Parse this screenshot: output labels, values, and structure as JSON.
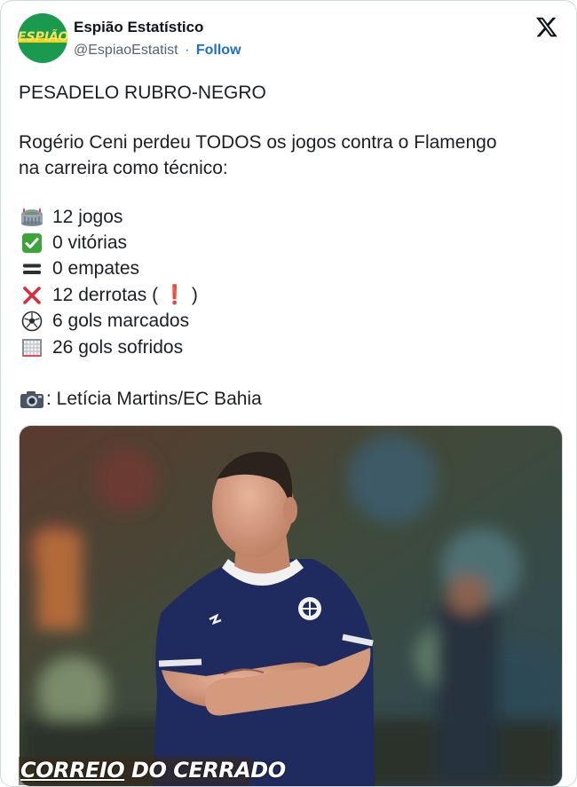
{
  "account": {
    "name": "Espião Estatístico",
    "handle": "@EspiaoEstatist",
    "separator": "·",
    "follow_label": "Follow",
    "avatar_text": "ESPIÃO"
  },
  "tweet": {
    "headline": "PESADELO RUBRO-NEGRO",
    "body_line1": "Rogério Ceni perdeu TODOS os jogos contra o Flamengo",
    "body_line2": "na carreira como técnico:",
    "stats": [
      {
        "icon": "stadium-icon",
        "text": "12 jogos"
      },
      {
        "icon": "check-mark-icon",
        "text": "0 vitórias"
      },
      {
        "icon": "equals-icon",
        "text": "0 empates"
      },
      {
        "icon": "cross-mark-icon",
        "text": "12 derrotas ( ❗ )"
      },
      {
        "icon": "soccer-ball-icon",
        "text": "6 gols marcados"
      },
      {
        "icon": "goal-net-icon",
        "text": "26 gols sofridos"
      }
    ],
    "photo_credit": ": Letícia Martins/EC Bahia"
  },
  "watermark": {
    "part1": "CORREIO",
    "part2": " DO CERRADO"
  },
  "colors": {
    "follow_blue": "#1d6fc9",
    "check_green": "#3aa637",
    "cross_red": "#d82d3c",
    "jersey_navy": "#1f2a5e",
    "avatar_green": "#1a9a4f"
  }
}
